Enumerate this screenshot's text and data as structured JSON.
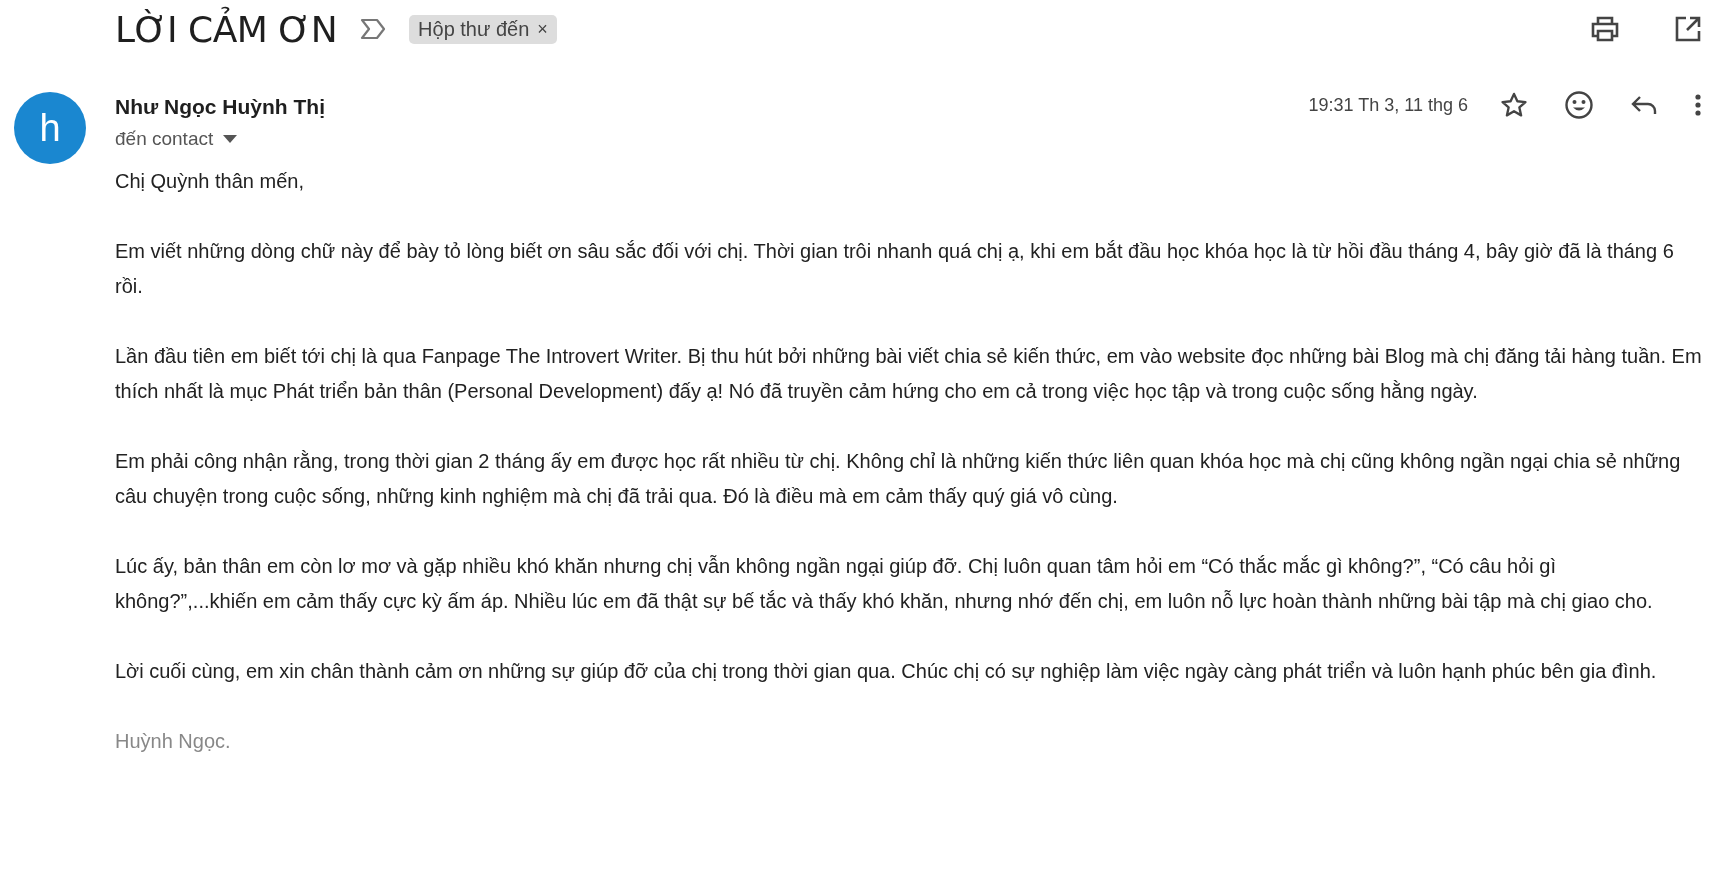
{
  "subject": "LỜI CẢM ƠN",
  "label": {
    "text": "Hộp thư đến",
    "remove": "×"
  },
  "sender": {
    "avatar": "h",
    "name": "Như Ngọc Huỳnh Thị",
    "recipient": "đến contact"
  },
  "date": "19:31 Th 3, 11 thg 6",
  "starred": false,
  "body": [
    "Chị Quỳnh thân mến,",
    "Em viết những dòng chữ này để bày tỏ lòng biết ơn sâu sắc đối với chị. Thời gian trôi nhanh quá chị ạ, khi em bắt đầu học khóa học là từ hồi đầu tháng 4, bây giờ đã là tháng 6 rồi.",
    "Lần đầu tiên em biết tới chị là qua Fanpage The Introvert Writer. Bị thu hút bởi những bài viết chia sẻ kiến thức, em vào website đọc những bài Blog mà chị đăng tải hàng tuần. Em thích nhất là mục Phát triển bản thân (Personal Development) đấy ạ! Nó đã truyền cảm hứng cho em cả trong việc học tập và trong cuộc sống hằng ngày.",
    "Em phải công nhận rằng, trong thời gian 2 tháng ấy em được học rất nhiều từ chị. Không chỉ là những kiến thức liên quan khóa học mà chị cũng không ngần ngại chia sẻ những câu chuyện trong cuộc sống, những kinh nghiệm mà chị đã trải qua. Đó là điều mà em cảm thấy quý giá vô cùng.",
    "Lúc ấy, bản thân em còn lơ mơ và gặp nhiều khó khăn nhưng chị vẫn không ngần ngại giúp đỡ. Chị luôn quan tâm hỏi em “Có thắc mắc gì không?”, “Có câu hỏi gì không?”,...khiến em cảm thấy cực kỳ ấm áp. Nhiều lúc em đã thật sự bế tắc và thấy khó khăn, nhưng nhớ đến chị, em luôn nỗ lực hoàn thành những bài tập mà chị giao cho.",
    "Lời cuối cùng, em xin chân thành cảm ơn những sự giúp đỡ của chị trong thời gian qua. Chúc chị có sự nghiệp làm việc ngày càng phát triển và luôn hạnh phúc bên gia đình."
  ],
  "signature": "Huỳnh Ngọc."
}
